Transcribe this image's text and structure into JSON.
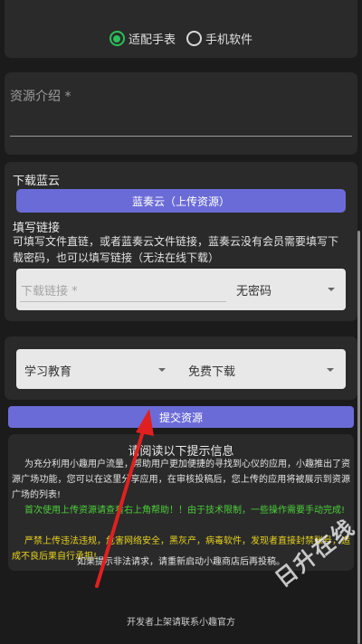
{
  "radio": {
    "options": [
      {
        "label": "适配手表",
        "selected": true
      },
      {
        "label": "手机软件",
        "selected": false
      }
    ],
    "accent": "#2bbf5a"
  },
  "description": {
    "label": "资源介绍 *"
  },
  "download": {
    "title": "下载蓝云",
    "upload_button": "蓝奏云（上传资源）",
    "link_title": "填写链接",
    "link_desc": "可填写文件直链，或者蓝奏云文件链接，蓝奏云没有会员需要填写下载密码，也可以填写链接（无法在线下载）",
    "link_placeholder": "下载链接 *",
    "password_option": "无密码"
  },
  "category": {
    "selected": "学习教育",
    "download_type": "免费下载"
  },
  "submit_button": "提交资源",
  "notice": {
    "title": "请阅读以下提示信息",
    "p1": "为充分利用小趣用户流量，帮助用户更加便捷的寻找到心仪的应用，小趣推出了资源广场功能，您可以在这里分享应用，在审核投稿后，您上传的应用将被展示到资源广场的列表!",
    "p2": "首次使用上传资源请查看右上角帮助！！由于技术限制，一些操作需要手动完成!",
    "p3": "严禁上传违法违规，危害网络安全，黑灰产，病毒软件，发现者直接封禁账号，造成不良后果自行承担!",
    "p4": "如果提示非法请求，请重新启动小趣商店后再投稿。",
    "colors": {
      "green": "#4ccf3a",
      "yellow": "#e8d31e"
    }
  },
  "footer": "开发者上架请联系小趣官方",
  "watermark": "日升在线",
  "brand_color": "#6b6bd8"
}
